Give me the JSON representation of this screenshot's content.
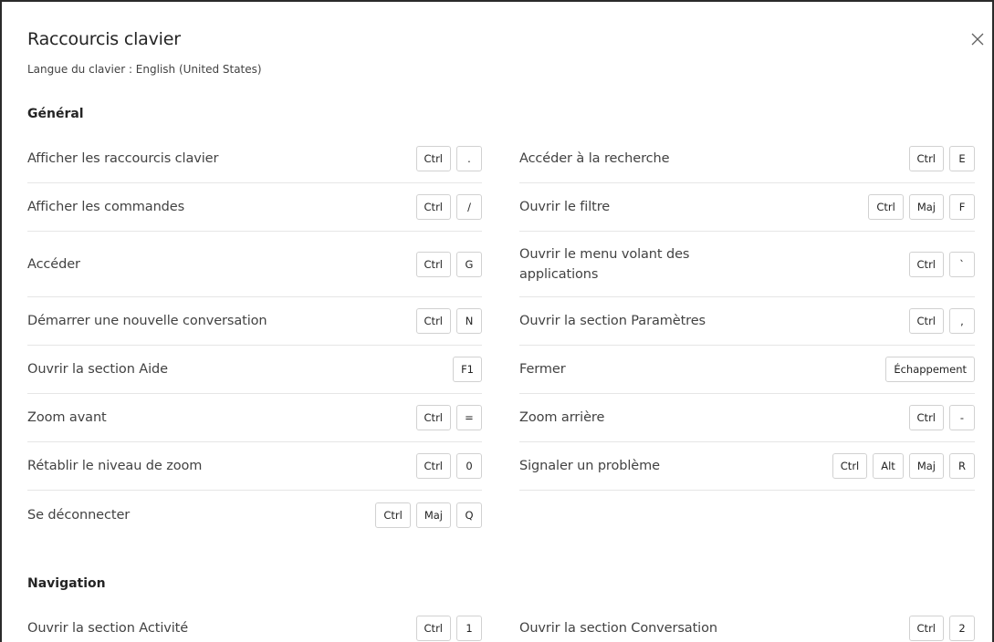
{
  "dialog": {
    "title": "Raccourcis clavier",
    "subtitle": "Langue du clavier : English (United States)",
    "close_icon": "close-icon"
  },
  "sections": [
    {
      "title": "Général",
      "left": [
        {
          "label": "Afficher les raccourcis clavier",
          "keys": [
            "Ctrl",
            "."
          ]
        },
        {
          "label": "Afficher les commandes",
          "keys": [
            "Ctrl",
            "/"
          ]
        },
        {
          "label": "Accéder",
          "keys": [
            "Ctrl",
            "G"
          ]
        },
        {
          "label": "Démarrer une nouvelle conversation",
          "keys": [
            "Ctrl",
            "N"
          ]
        },
        {
          "label": "Ouvrir la section Aide",
          "keys": [
            "F1"
          ]
        },
        {
          "label": "Zoom avant",
          "keys": [
            "Ctrl",
            "="
          ]
        },
        {
          "label": "Rétablir le niveau de zoom",
          "keys": [
            "Ctrl",
            "0"
          ]
        },
        {
          "label": "Se déconnecter",
          "keys": [
            "Ctrl",
            "Maj",
            "Q"
          ]
        }
      ],
      "right": [
        {
          "label": "Accéder à la recherche",
          "keys": [
            "Ctrl",
            "E"
          ]
        },
        {
          "label": "Ouvrir le filtre",
          "keys": [
            "Ctrl",
            "Maj",
            "F"
          ]
        },
        {
          "label": "Ouvrir le menu volant des applications",
          "keys": [
            "Ctrl",
            "`"
          ]
        },
        {
          "label": "Ouvrir la section Paramètres",
          "keys": [
            "Ctrl",
            ","
          ]
        },
        {
          "label": "Fermer",
          "keys": [
            "Échappement"
          ]
        },
        {
          "label": "Zoom arrière",
          "keys": [
            "Ctrl",
            "-"
          ]
        },
        {
          "label": "Signaler un problème",
          "keys": [
            "Ctrl",
            "Alt",
            "Maj",
            "R"
          ]
        }
      ]
    },
    {
      "title": "Navigation",
      "left": [
        {
          "label": "Ouvrir la section Activité",
          "keys": [
            "Ctrl",
            "1"
          ]
        }
      ],
      "right": [
        {
          "label": "Ouvrir la section Conversation",
          "keys": [
            "Ctrl",
            "2"
          ]
        }
      ]
    }
  ]
}
